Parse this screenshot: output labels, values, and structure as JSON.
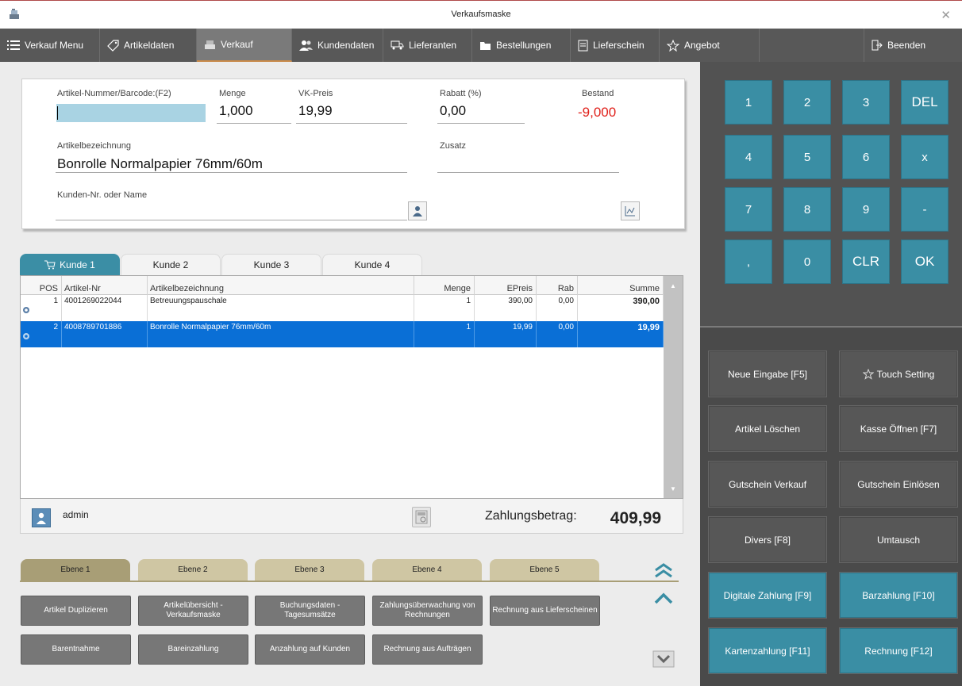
{
  "window": {
    "title": "Verkaufsmaske"
  },
  "menu": [
    {
      "label": "Verkauf Menu",
      "icon": "list-icon"
    },
    {
      "label": "Artikeldaten",
      "icon": "tag-icon"
    },
    {
      "label": "Verkauf",
      "icon": "cash-register-icon",
      "active": true
    },
    {
      "label": "Kundendaten",
      "icon": "users-icon"
    },
    {
      "label": "Lieferanten",
      "icon": "truck-icon"
    },
    {
      "label": "Bestellungen",
      "icon": "folder-icon"
    },
    {
      "label": "Lieferschein",
      "icon": "document-icon"
    },
    {
      "label": "Angebot",
      "icon": "star-icon"
    },
    {
      "label": "Beenden",
      "icon": "exit-icon"
    }
  ],
  "entry": {
    "barcode_label": "Artikel-Nummer/Barcode:(F2)",
    "barcode_value": "",
    "menge_label": "Menge",
    "menge_value": "1,000",
    "vkpreis_label": "VK-Preis",
    "vkpreis_value": "19,99",
    "rabatt_label": "Rabatt (%)",
    "rabatt_value": "0,00",
    "bestand_label": "Bestand",
    "bestand_value": "-9,000",
    "bezeichnung_label": "Artikelbezeichnung",
    "bezeichnung_value": "Bonrolle Normalpapier 76mm/60m",
    "zusatz_label": "Zusatz",
    "zusatz_value": "",
    "kunde_label": "Kunden-Nr. oder Name",
    "kunde_value": ""
  },
  "tabs": [
    "Kunde 1",
    "Kunde 2",
    "Kunde 3",
    "Kunde 4"
  ],
  "grid": {
    "columns": [
      "POS",
      "Artikel-Nr",
      "Artikelbezeichnung",
      "Menge",
      "EPreis",
      "Rab",
      "Summe"
    ],
    "rows": [
      {
        "pos": "1",
        "nr": "4001269022044",
        "bez": "Betreuungspauschale",
        "menge": "1",
        "epreis": "390,00",
        "rab": "0,00",
        "summe": "390,00"
      },
      {
        "pos": "2",
        "nr": "4008789701886",
        "bez": "Bonrolle Normalpapier 76mm/60m",
        "menge": "1",
        "epreis": "19,99",
        "rab": "0,00",
        "summe": "19,99"
      }
    ]
  },
  "footer": {
    "user": "admin",
    "zahlung_label": "Zahlungsbetrag:",
    "zahlung_value": "409,99"
  },
  "ebenen": [
    "Ebene 1",
    "Ebene 2",
    "Ebene 3",
    "Ebene 4",
    "Ebene 5"
  ],
  "functions": {
    "row1": [
      "Artikel Duplizieren",
      "Artikelübersicht - Verkaufsmaske",
      "Buchungsdaten - Tagesumsätze",
      "Zahlungsüberwachung von Rechnungen",
      "Rechnung aus Lieferscheinen"
    ],
    "row2": [
      "Barentnahme",
      "Bareinzahlung",
      "Anzahlung auf Kunden",
      "Rechnung aus Aufträgen"
    ]
  },
  "keypad": [
    "1",
    "2",
    "3",
    "DEL",
    "4",
    "5",
    "6",
    "x",
    "7",
    "8",
    "9",
    "-",
    ",",
    "0",
    "CLR",
    "OK"
  ],
  "actions": [
    {
      "label": "Neue Eingabe [F5]",
      "style": "gray"
    },
    {
      "label": "Touch Setting",
      "style": "gray",
      "icon": "gear-star-icon"
    },
    {
      "label": "Artikel Löschen",
      "style": "gray"
    },
    {
      "label": "Kasse Öffnen [F7]",
      "style": "gray"
    },
    {
      "label": "Gutschein Verkauf",
      "style": "gray"
    },
    {
      "label": "Gutschein Einlösen",
      "style": "gray"
    },
    {
      "label": "Divers [F8]",
      "style": "gray"
    },
    {
      "label": "Umtausch",
      "style": "gray"
    },
    {
      "label": "Digitale Zahlung [F9]",
      "style": "blue"
    },
    {
      "label": "Barzahlung [F10]",
      "style": "blue"
    },
    {
      "label": "Kartenzahlung [F11]",
      "style": "blue"
    },
    {
      "label": "Rechnung [F12]",
      "style": "blue"
    }
  ],
  "colors": {
    "accent": "#3a8ea4",
    "selection": "#0a6fd6",
    "negative": "#e0201a",
    "ebene": "#cfc6a3"
  }
}
